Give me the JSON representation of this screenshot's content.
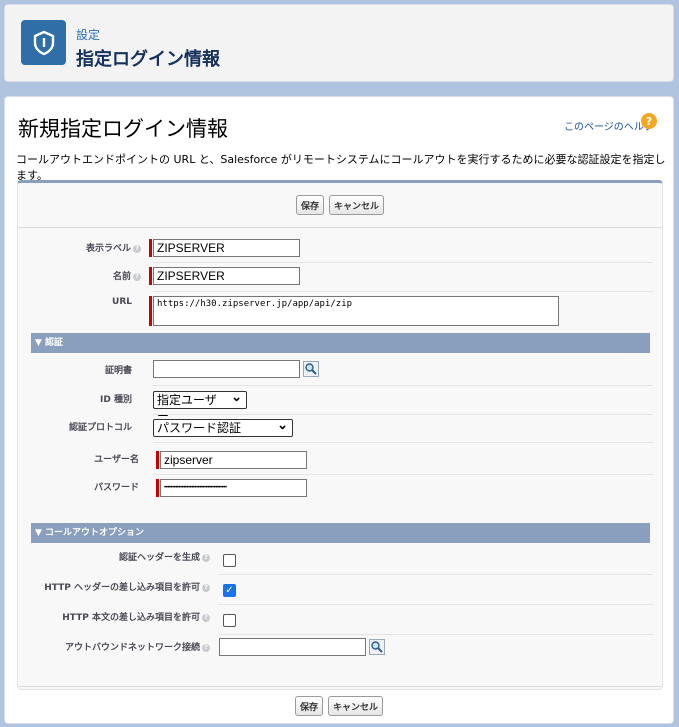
{
  "header": {
    "breadcrumb": "設定",
    "title": "指定ログイン情報",
    "icon": "shield-icon"
  },
  "page": {
    "title": "新規指定ログイン情報",
    "help_link": "このページのヘルプ",
    "description": "コールアウトエンドポイントの URL と、Salesforce がリモートシステムにコールアウトを実行するために必要な認証設定を指定します。"
  },
  "buttons": {
    "save": "保存",
    "cancel": "キャンセル"
  },
  "fields": {
    "label": {
      "label": "表示ラベル",
      "value": "ZIPSERVER"
    },
    "name": {
      "label": "名前",
      "value": "ZIPSERVER"
    },
    "url": {
      "label": "URL",
      "value": "https://h30.zipserver.jp/app/api/zip"
    }
  },
  "auth_section": {
    "title": "▼ 認証",
    "certificate": {
      "label": "証明書",
      "value": ""
    },
    "identity_type": {
      "label": "ID 種別",
      "value": "指定ユーザー"
    },
    "protocol": {
      "label": "認証プロトコル",
      "value": "パスワード認証"
    },
    "username": {
      "label": "ユーザー名",
      "value": "zipserver"
    },
    "password": {
      "label": "パスワード",
      "value": "•••••••••••••••••••••••••••••••••••••••"
    }
  },
  "callout_section": {
    "title": "▼ コールアウトオプション",
    "gen_auth_header": {
      "label": "認証ヘッダーを生成",
      "checked": false
    },
    "allow_header_merge": {
      "label": "HTTP ヘッダーの差し込み項目を許可",
      "checked": true
    },
    "allow_body_merge": {
      "label": "HTTP 本文の差し込み項目を許可",
      "checked": false
    },
    "outbound_network": {
      "label": "アウトバウンドネットワーク接続",
      "value": ""
    }
  },
  "colors": {
    "background": "#b0c4df",
    "brand_icon": "#2f6ea6",
    "section_header": "#8a9ebe",
    "required": "#cc0000",
    "checkbox_checked": "#1a73e8"
  }
}
